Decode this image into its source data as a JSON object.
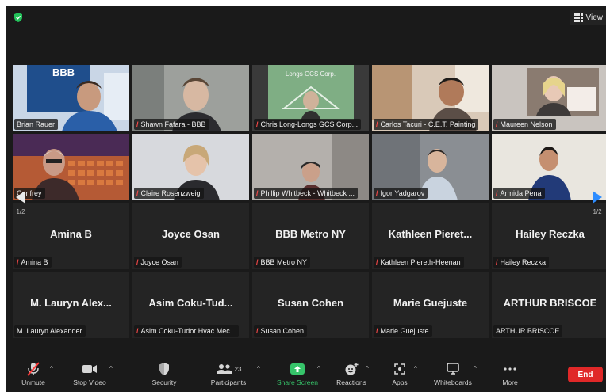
{
  "app": {
    "view_label": "View"
  },
  "pager": {
    "left": "1/2",
    "right": "1/2"
  },
  "tiles": [
    {
      "name": "Brian Rauer",
      "muted": false
    },
    {
      "name": "Shawn Fafara - BBB",
      "muted": true
    },
    {
      "name": "Chris Long-Longs GCS Corp...",
      "muted": true,
      "bg_text": "Longs GCS Corp."
    },
    {
      "name": "Carlos Tacuri - C.E.T. Painting",
      "muted": true
    },
    {
      "name": "Maureen Nelson",
      "muted": true
    },
    {
      "name": "Confrey",
      "muted": false
    },
    {
      "name": "Claire Rosenzweig",
      "muted": true
    },
    {
      "name": "Phillip Whitbeck - Whitbeck ...",
      "muted": true
    },
    {
      "name": "Igor Yadgarov",
      "muted": true
    },
    {
      "name": "Armida Pena",
      "muted": true
    },
    {
      "big": "Amina B",
      "name": "Amina B",
      "muted": true
    },
    {
      "big": "Joyce Osan",
      "name": "Joyce Osan",
      "muted": true
    },
    {
      "big": "BBB Metro NY",
      "name": "BBB Metro NY",
      "muted": true
    },
    {
      "big": "Kathleen  Pieret...",
      "name": "Kathleen Piereth-Heenan",
      "muted": true
    },
    {
      "big": "Hailey Reczka",
      "name": "Hailey Reczka",
      "muted": true
    },
    {
      "big": "M. Lauryn Alex...",
      "name": "M. Lauryn Alexander",
      "muted": false
    },
    {
      "big": "Asim Coku-Tud...",
      "name": "Asim Coku-Tudor Hvac Mec...",
      "muted": true
    },
    {
      "big": "Susan Cohen",
      "name": "Susan Cohen",
      "muted": true
    },
    {
      "big": "Marie Guejuste",
      "name": "Marie Guejuste",
      "muted": true
    },
    {
      "big": "ARTHUR BRISCOE",
      "name": "ARTHUR BRISCOE",
      "muted": false
    }
  ],
  "toolbar": {
    "unmute": "Unmute",
    "stop_video": "Stop Video",
    "security": "Security",
    "participants": "Participants",
    "participants_count": "23",
    "share_screen": "Share Screen",
    "reactions": "Reactions",
    "apps": "Apps",
    "whiteboards": "Whiteboards",
    "more": "More",
    "end": "End"
  },
  "colors": {
    "accent": "#2d8cff",
    "share": "#36c46a",
    "end": "#e02828",
    "speaker_outline": "#e4e87a"
  }
}
